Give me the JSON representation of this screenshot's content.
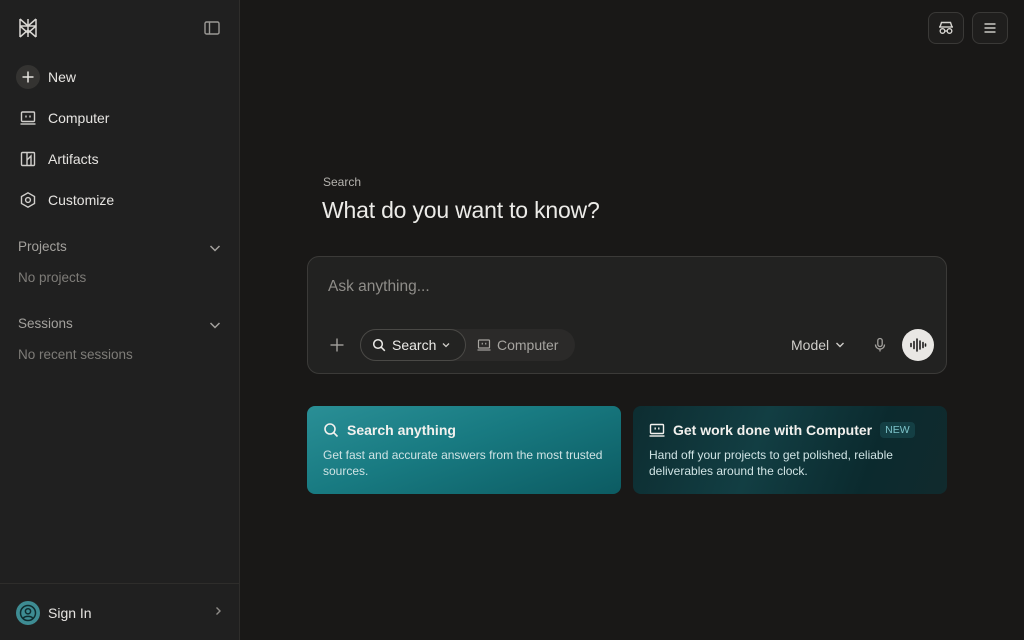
{
  "sidebar": {
    "nav": [
      {
        "label": "New",
        "icon": "plus-icon"
      },
      {
        "label": "Computer",
        "icon": "computer-icon"
      },
      {
        "label": "Artifacts",
        "icon": "artifacts-icon"
      },
      {
        "label": "Customize",
        "icon": "customize-icon"
      }
    ],
    "projects": {
      "title": "Projects",
      "empty": "No projects"
    },
    "sessions": {
      "title": "Sessions",
      "empty": "No recent sessions"
    },
    "footer": {
      "signin_label": "Sign In"
    }
  },
  "main": {
    "eyebrow": "Search",
    "headline": "What do you want to know?",
    "composer": {
      "placeholder": "Ask anything...",
      "mode_search": "Search",
      "mode_computer": "Computer",
      "model_label": "Model"
    },
    "cards": [
      {
        "title": "Search anything",
        "description": "Get fast and accurate answers from the most trusted sources."
      },
      {
        "title": "Get work done with Computer",
        "badge": "NEW",
        "description": "Hand off your projects to get polished, reliable deliverables around the clock."
      }
    ]
  },
  "colors": {
    "background": "#191817",
    "sidebar": "#202020",
    "accent_teal": "#1f8a91",
    "text": "#e8e6e3"
  }
}
